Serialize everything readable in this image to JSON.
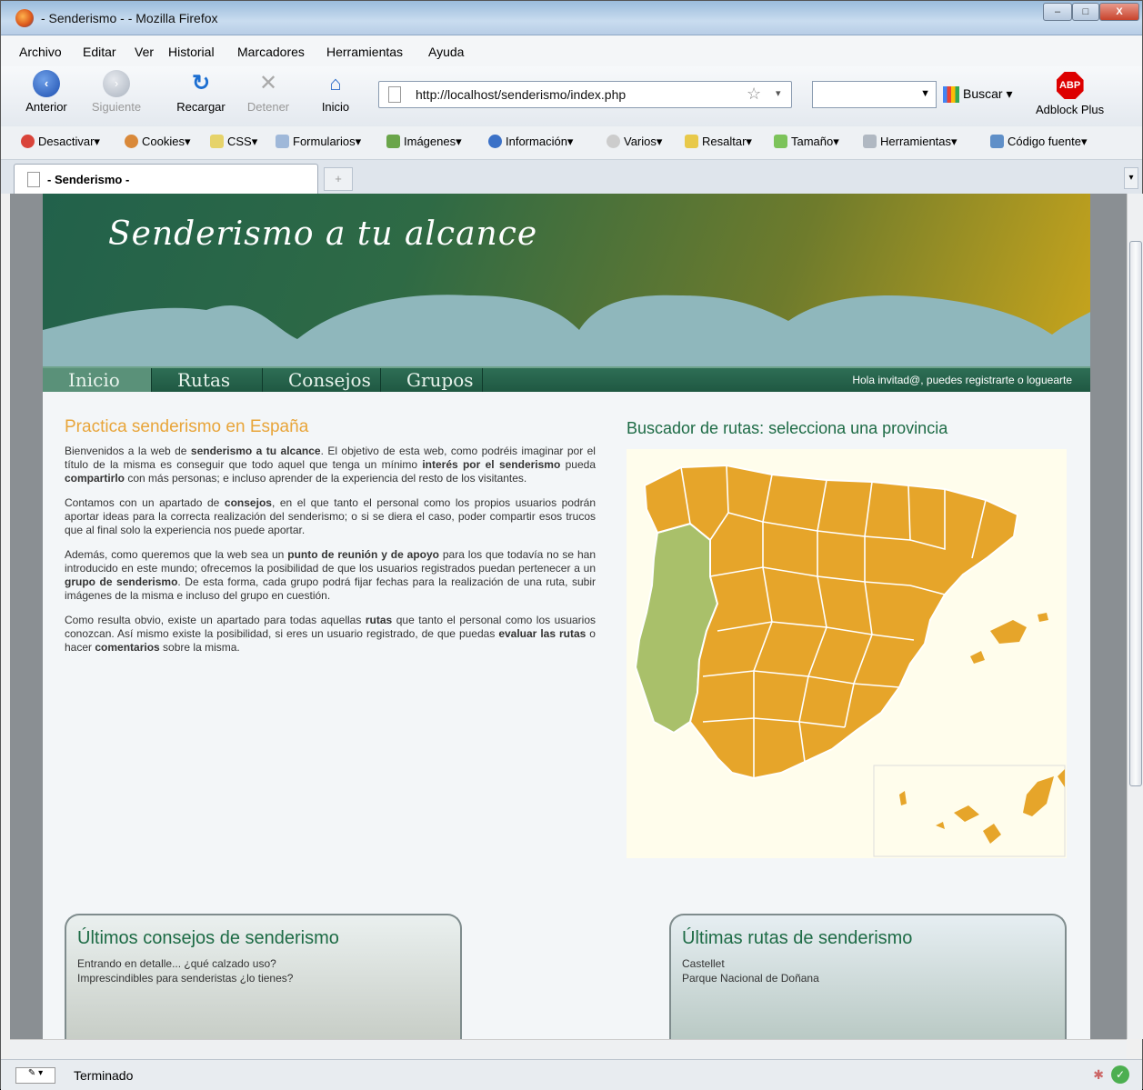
{
  "window": {
    "title": "- Senderismo - - Mozilla Firefox",
    "controls": {
      "minimize": "–",
      "maximize": "□",
      "close": "X"
    }
  },
  "menu": [
    "Archivo",
    "Editar",
    "Ver",
    "Historial",
    "Marcadores",
    "Herramientas",
    "Ayuda"
  ],
  "navbar": {
    "back": "Anterior",
    "forward": "Siguiente",
    "reload": "Recargar",
    "stop": "Detener",
    "home": "Inicio",
    "url": "http://localhost/senderismo/index.php",
    "search_label": "Buscar",
    "adblock": "Adblock Plus",
    "adblock_badge": "ABP"
  },
  "webdev_toolbar": [
    "Desactivar",
    "Cookies",
    "CSS",
    "Formularios",
    "Imágenes",
    "Información",
    "Varios",
    "Resaltar",
    "Tamaño",
    "Herramientas",
    "Código fuente"
  ],
  "tab": {
    "label": "- Senderismo -"
  },
  "status": {
    "text": "Terminado"
  },
  "site": {
    "logo": "Senderismo a tu alcance",
    "nav": [
      "Inicio",
      "Rutas",
      "Consejos",
      "Grupos"
    ],
    "greeting": "Hola invitad@, puedes registrarte o loguearte",
    "intro": {
      "title": "Practica senderismo en España",
      "p1": [
        {
          "t": "Bienvenidos a la web de "
        },
        {
          "t": "senderismo a tu alcance",
          "b": true
        },
        {
          "t": ". El objetivo de esta web, como podréis imaginar por el título de la misma es conseguir que todo aquel que tenga un mínimo "
        },
        {
          "t": "interés por el senderismo",
          "b": true
        },
        {
          "t": " pueda "
        },
        {
          "t": "compartirlo",
          "b": true
        },
        {
          "t": " con más personas; e incluso aprender de la experiencia del resto de los visitantes."
        }
      ],
      "p2": [
        {
          "t": "Contamos con un apartado de "
        },
        {
          "t": "consejos",
          "b": true
        },
        {
          "t": ", en el que tanto el personal como los propios usuarios podrán aportar ideas para la correcta realización del senderismo; o si se diera el caso, poder compartir esos trucos que al final solo la experiencia nos puede aportar."
        }
      ],
      "p3": [
        {
          "t": "Además, como queremos que la web sea un "
        },
        {
          "t": "punto de reunión y de apoyo",
          "b": true
        },
        {
          "t": " para los que todavía no se han introducido en este mundo; ofrecemos la posibilidad de que los usuarios registrados puedan pertenecer a un "
        },
        {
          "t": "grupo de senderismo",
          "b": true
        },
        {
          "t": ". De esta forma, cada grupo podrá fijar fechas para la realización de una ruta, subir imágenes de la misma e incluso del grupo en cuestión."
        }
      ],
      "p4": [
        {
          "t": "Como resulta obvio, existe un apartado para todas aquellas "
        },
        {
          "t": "rutas",
          "b": true
        },
        {
          "t": " que tanto el personal como los usuarios conozcan. Así mismo existe la posibilidad, si eres un usuario registrado, de que puedas "
        },
        {
          "t": "evaluar las rutas",
          "b": true
        },
        {
          "t": " o hacer "
        },
        {
          "t": "comentarios",
          "b": true
        },
        {
          "t": " sobre la misma."
        }
      ]
    },
    "map_title": "Buscador de rutas: selecciona una provincia",
    "tips": {
      "title": "Últimos consejos de senderismo",
      "items": [
        "Entrando en detalle... ¿qué calzado uso?",
        "Imprescindibles para senderistas ¿lo tienes?"
      ]
    },
    "routes": {
      "title": "Últimas rutas de senderismo",
      "items": [
        "Castellet",
        "Parque Nacional de Doñana"
      ]
    },
    "colors": {
      "spain": "#e6a52a",
      "portugal": "#a9c06a",
      "heading_orange": "#e8a53a",
      "heading_green": "#1d6b45"
    }
  }
}
